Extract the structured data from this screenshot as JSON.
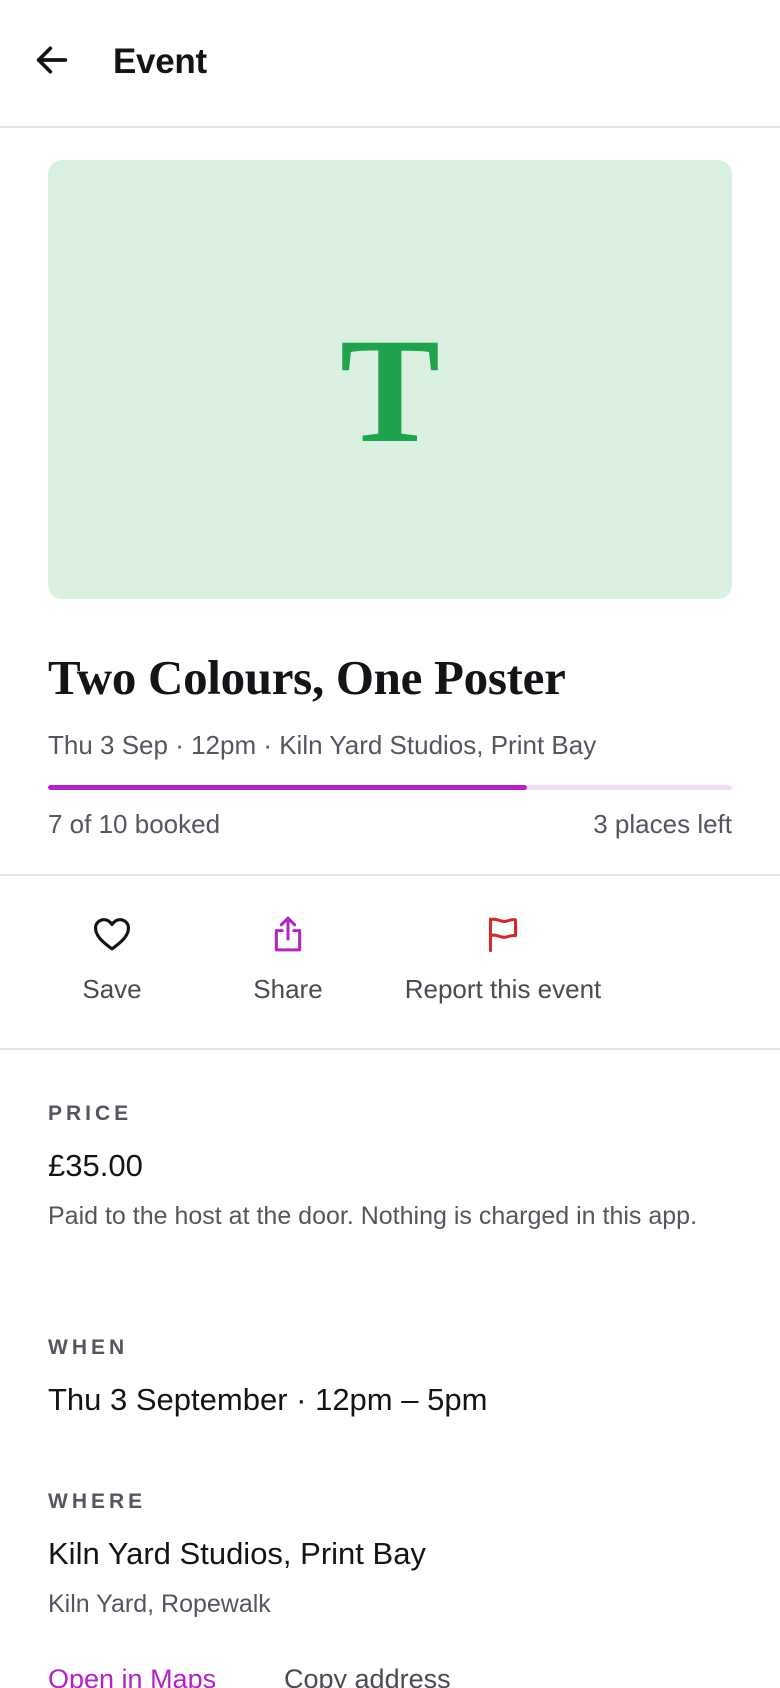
{
  "header": {
    "title": "Event",
    "back_icon": "arrow-left-icon"
  },
  "hero": {
    "letter": "T",
    "background": "#daf0e1",
    "letter_color": "#1fa34d"
  },
  "event": {
    "title": "Two Colours, One Poster",
    "meta": "Thu 3 Sep · 12pm · Kiln Yard Studios, Print Bay",
    "booked_text": "7 of 10 booked",
    "places_left": "3 places left",
    "booked_fraction": 0.7,
    "accent": "#b422c7"
  },
  "actions": [
    {
      "label": "Save",
      "icon": "heart-icon"
    },
    {
      "label": "Share",
      "icon": "share-icon",
      "color": "#b422c7"
    },
    {
      "label": "Report this event",
      "icon": "flag-icon",
      "color": "#d4282c"
    }
  ],
  "price": {
    "label": "PRICE",
    "value": "£35.00",
    "note": "Paid to the host at the door. Nothing is charged in this app."
  },
  "when": {
    "label": "WHEN",
    "value": "Thu 3 September · 12pm – 5pm"
  },
  "where": {
    "label": "WHERE",
    "venue": "Kiln Yard Studios, Print Bay",
    "address": "Kiln Yard, Ropewalk",
    "maps_link": "Open in Maps",
    "copy_link": "Copy address"
  }
}
